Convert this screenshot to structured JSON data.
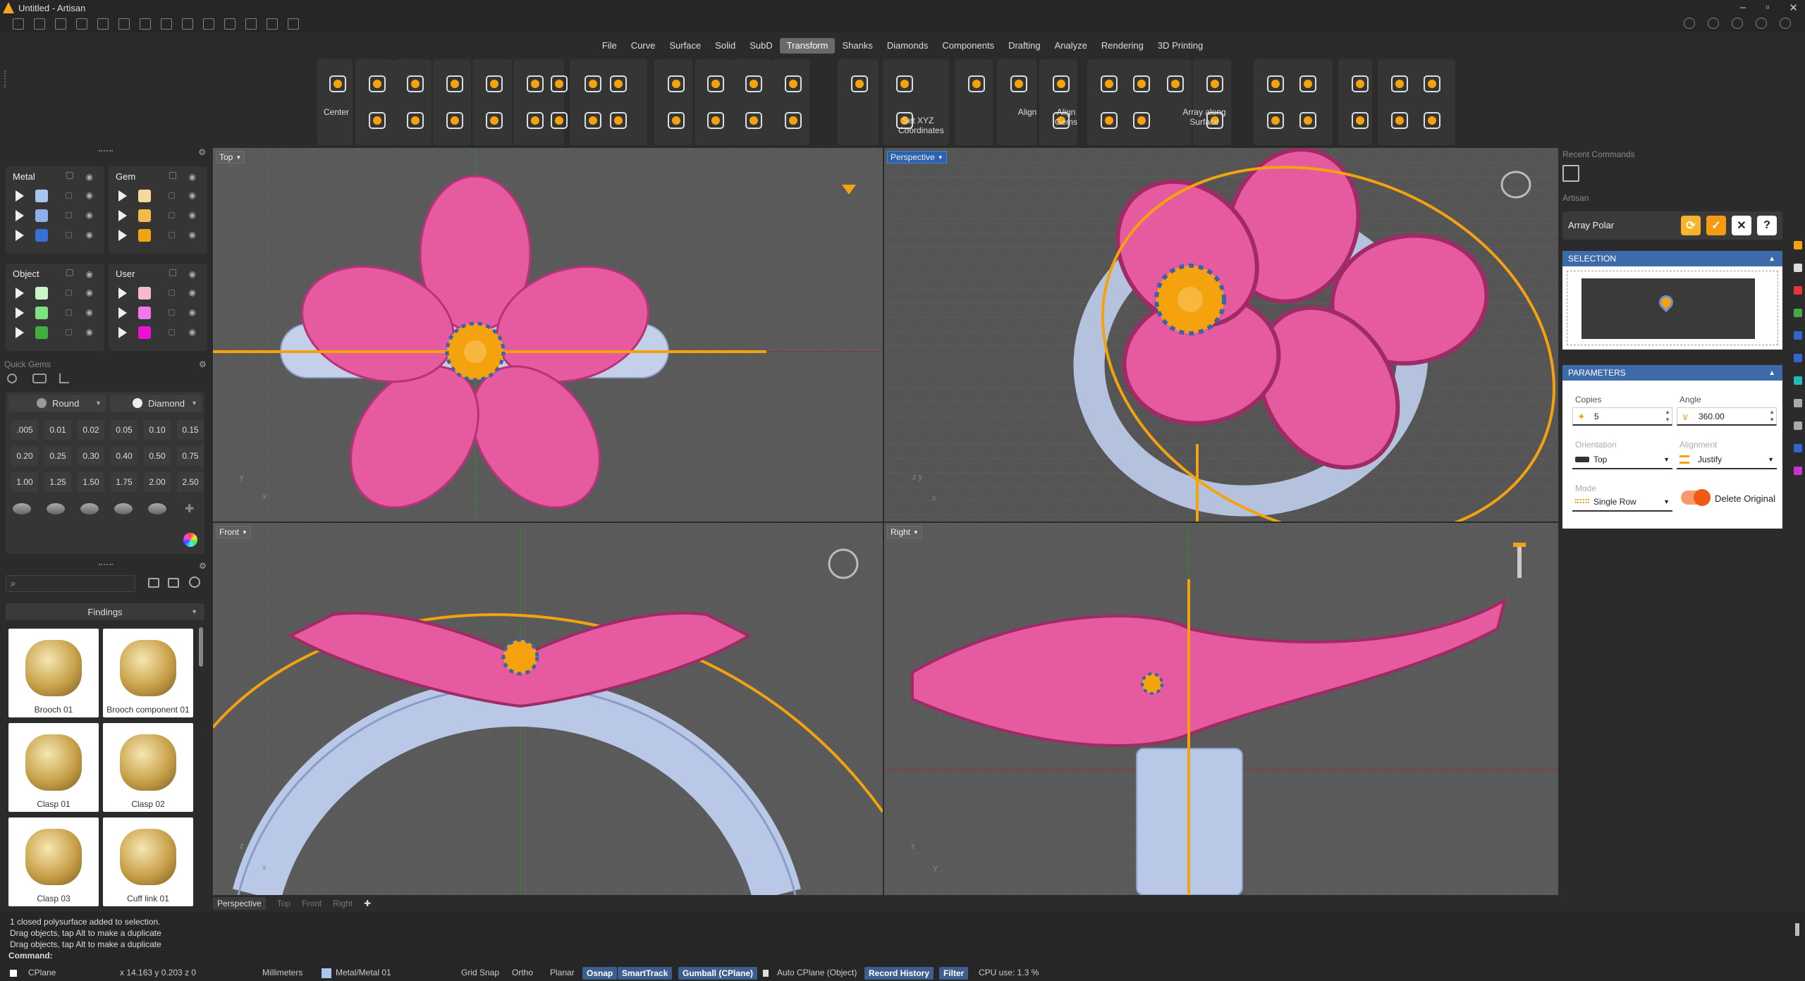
{
  "window": {
    "title": "Untitled - Artisan"
  },
  "menu": [
    "File",
    "Curve",
    "Surface",
    "Solid",
    "SubD",
    "Transform",
    "Shanks",
    "Diamonds",
    "Components",
    "Drafting",
    "Analyze",
    "Rendering",
    "3D Printing"
  ],
  "menu_active": "Transform",
  "ribbon": {
    "center": "Center",
    "set_xyz_line1": "Set XYZ",
    "set_xyz_line2": "Coordinates",
    "align": "Align",
    "align_gems_line1": "Align",
    "align_gems_line2": "Gems",
    "array_surface_line1": "Array along",
    "array_surface_line2": "Surface"
  },
  "layers": {
    "metal": {
      "title": "Metal",
      "colors": [
        "#a9c6f0",
        "#8fb0ec",
        "#3b6fd8"
      ]
    },
    "gem": {
      "title": "Gem",
      "colors": [
        "#f6d89a",
        "#f2bb4a",
        "#f0a614"
      ]
    },
    "object": {
      "title": "Object",
      "colors": [
        "#c9f5c9",
        "#7fe07f",
        "#3fae3f"
      ]
    },
    "user": {
      "title": "User",
      "colors": [
        "#f5b8d3",
        "#ee78ec",
        "#ee10d8"
      ]
    }
  },
  "quick_gems": {
    "label": "Quick Gems",
    "cut": "Round",
    "material": "Diamond",
    "sizes": [
      ".005",
      "0.01",
      "0.02",
      "0.05",
      "0.10",
      "0.15",
      "0.20",
      "0.25",
      "0.30",
      "0.40",
      "0.50",
      "0.75",
      "1.00",
      "1.25",
      "1.50",
      "1.75",
      "2.00",
      "2.50"
    ]
  },
  "library": {
    "category": "Findings",
    "items": [
      "Brooch 01",
      "Brooch component 01",
      "Clasp 01",
      "Clasp 02",
      "Clasp 03",
      "Cuff link 01"
    ]
  },
  "viewports": {
    "top": "Top",
    "perspective": "Perspective",
    "front": "Front",
    "right": "Right"
  },
  "viewport_tabs": [
    "Perspective",
    "Top",
    "Front",
    "Right"
  ],
  "viewport_tab_active": "Perspective",
  "right_panel": {
    "recent_commands": "Recent Commands",
    "artisan": "Artisan",
    "command_name": "Array Polar",
    "selection_header": "SELECTION",
    "parameters_header": "PARAMETERS",
    "copies_label": "Copies",
    "copies_value": "5",
    "angle_label": "Angle",
    "angle_value": "360.00",
    "orientation_label": "Orientation",
    "orientation_value": "Top",
    "alignment_label": "Alignment",
    "alignment_value": "Justify",
    "mode_label": "Mode",
    "mode_value": "Single Row",
    "delete_original": "Delete Original",
    "delete_original_on": true
  },
  "command_history": [
    "1 closed polysurface added to selection.",
    "Drag objects, tap Alt to make a duplicate",
    "Drag objects, tap Alt to make a duplicate"
  ],
  "command_prompt": "Command:",
  "status": {
    "cplane": "CPlane",
    "coords": "x 14.163  y 0.203  z 0",
    "units": "Millimeters",
    "layer": "Metal/Metal 01",
    "grid_snap": "Grid Snap",
    "ortho": "Ortho",
    "planar": "Planar",
    "osnap": "Osnap",
    "smarttrack": "SmartTrack",
    "gumball": "Gumball (CPlane)",
    "auto_cplane": "Auto CPlane (Object)",
    "record_history": "Record History",
    "filter": "Filter",
    "cpu": "CPU use: 1.3 %"
  },
  "colors": {
    "accent": "#f5a20f",
    "petal": "#e65aa0",
    "shank": "#b9c8e6",
    "viewport_bg": "#5a5a5a"
  }
}
